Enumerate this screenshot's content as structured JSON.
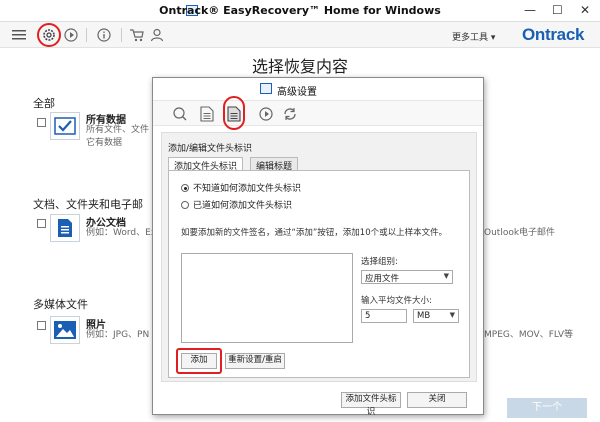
{
  "window": {
    "title": "Ontrack® EasyRecovery™ Home for Windows",
    "minimize": "—",
    "maximize": "☐",
    "close": "✕"
  },
  "toolbar": {
    "more_tools": "更多工具 ▾",
    "brand": "Ontrack"
  },
  "main": {
    "page_title": "选择恢复内容",
    "sections": [
      {
        "label": "全部",
        "tiles": [
          {
            "title": "所有数据",
            "desc1": "所有文件、文件",
            "desc2": "它有数据"
          }
        ]
      },
      {
        "label": "文档、文件夹和电子邮",
        "tiles": [
          {
            "title": "办公文档",
            "desc1": "例如：Word、Ex"
          },
          {
            "desc1": "Outlook电子邮件"
          }
        ]
      },
      {
        "label": "多媒体文件",
        "tiles": [
          {
            "title": "照片",
            "desc1": "例如：JPG、PN"
          },
          {
            "desc1": "MPEG、MOV、FLV等"
          }
        ]
      }
    ],
    "next_label": "下一个"
  },
  "dialog": {
    "title": "高级设置",
    "subtitle": "添加/编辑文件头标识",
    "tabs": [
      {
        "label": "添加文件头标识",
        "active": true
      },
      {
        "label": "编辑标题",
        "active": false
      }
    ],
    "radios": [
      {
        "label": "不知道如何添加文件头标识",
        "checked": true
      },
      {
        "label": "已道如何添加文件头标识",
        "checked": false
      }
    ],
    "instructions": "如要添加新的文件签名，通过“添加”按钮，添加10个或以上样本文件。",
    "group_label": "选择组别:",
    "group_value": "应用文件",
    "size_label": "输入平均文件大小:",
    "size_value": "5",
    "size_unit": "MB",
    "add_label": "添加",
    "reset_label": "重新设置/重启",
    "add_signature_label": "添加文件头标识",
    "close_label": "关闭"
  }
}
